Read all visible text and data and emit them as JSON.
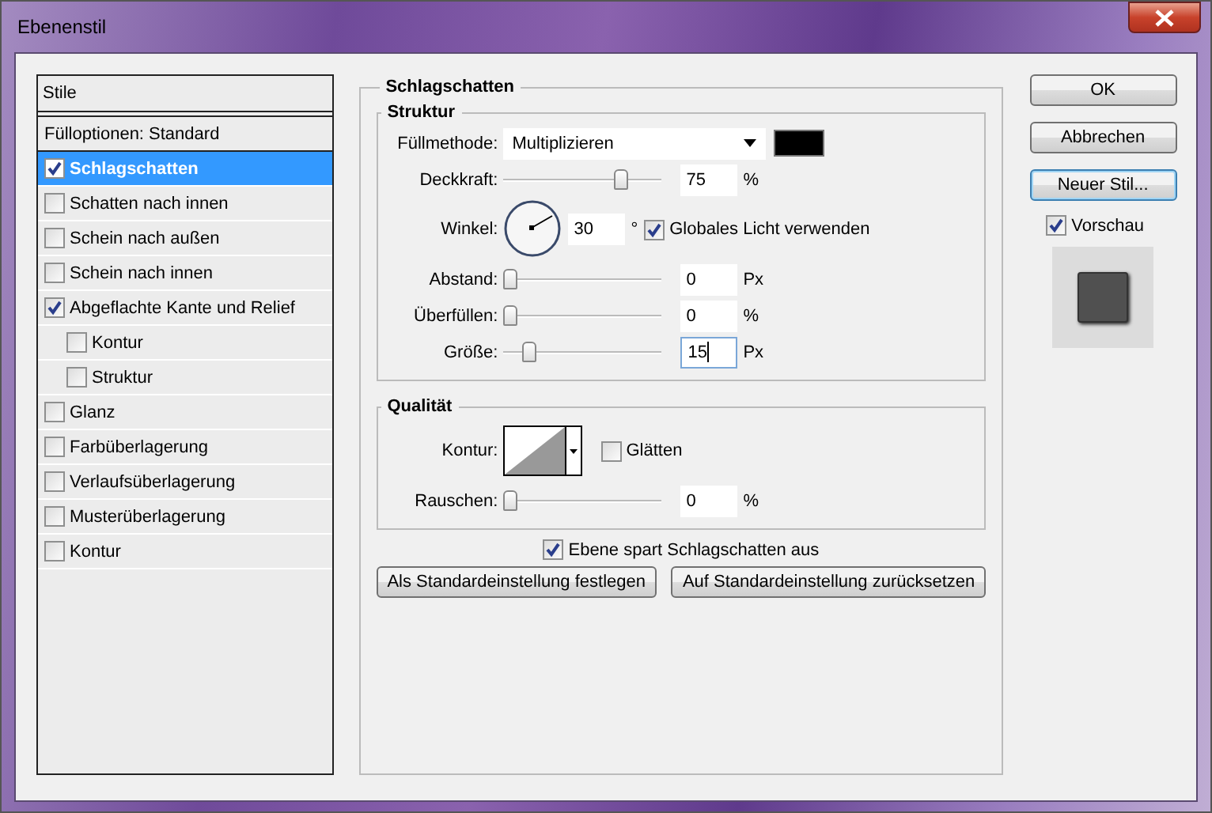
{
  "window": {
    "title": "Ebenenstil"
  },
  "styles": {
    "heading": "Stile",
    "items": [
      {
        "label": "Fülloptionen: Standard",
        "kind": "plain",
        "selected": false
      },
      {
        "label": "Schlagschatten",
        "kind": "check",
        "checked": true,
        "selected": true
      },
      {
        "label": "Schatten nach innen",
        "kind": "check",
        "checked": false,
        "selected": false
      },
      {
        "label": "Schein nach außen",
        "kind": "check",
        "checked": false,
        "selected": false
      },
      {
        "label": "Schein nach innen",
        "kind": "check",
        "checked": false,
        "selected": false
      },
      {
        "label": "Abgeflachte Kante und Relief",
        "kind": "check",
        "checked": true,
        "selected": false,
        "children": [
          {
            "label": "Kontur",
            "kind": "check",
            "checked": false,
            "selected": false
          },
          {
            "label": "Struktur",
            "kind": "check",
            "checked": false,
            "selected": false
          }
        ]
      },
      {
        "label": "Glanz",
        "kind": "check",
        "checked": false,
        "selected": false
      },
      {
        "label": "Farbüberlagerung",
        "kind": "check",
        "checked": false,
        "selected": false
      },
      {
        "label": "Verlaufsüberlagerung",
        "kind": "check",
        "checked": false,
        "selected": false
      },
      {
        "label": "Musterüberlagerung",
        "kind": "check",
        "checked": false,
        "selected": false
      },
      {
        "label": "Kontur",
        "kind": "check",
        "checked": false,
        "selected": false
      }
    ]
  },
  "panel": {
    "title": "Schlagschatten",
    "groups": [
      {
        "title": "Struktur",
        "rows": [
          {
            "kind": "blend",
            "label": "Füllmethode:",
            "value": "Multiplizieren",
            "color": "#000000"
          },
          {
            "kind": "slider",
            "label": "Deckkraft:",
            "level": 0.78,
            "value": "75",
            "unit": "%",
            "focused": false
          },
          {
            "kind": "angle",
            "label": "Winkel:",
            "value": "30",
            "unit": "°",
            "option": {
              "label": "Globales Licht verwenden",
              "checked": true
            }
          },
          {
            "kind": "slider",
            "label": "Abstand:",
            "level": 0,
            "value": "0",
            "unit": "Px",
            "focused": false
          },
          {
            "kind": "slider",
            "label": "Überfüllen:",
            "level": 0,
            "value": "0",
            "unit": "%",
            "focused": false
          },
          {
            "kind": "slider",
            "label": "Größe:",
            "level": 0.14,
            "value": "15",
            "unit": "Px",
            "focused": true
          }
        ]
      },
      {
        "title": "Qualität",
        "rows": [
          {
            "kind": "contour",
            "label": "Kontur:",
            "option": {
              "label": "Glätten",
              "checked": false
            }
          },
          {
            "kind": "slider",
            "label": "Rauschen:",
            "level": 0,
            "value": "0",
            "unit": "%",
            "focused": false
          }
        ]
      }
    ],
    "knockout": {
      "label": "Ebene spart Schlagschatten aus",
      "checked": true
    },
    "buttons": [
      "Als Standardeinstellung festlegen",
      "Auf Standardeinstellung zurücksetzen"
    ]
  },
  "actions": [
    {
      "label": "OK",
      "focused": false
    },
    {
      "label": "Abbrechen",
      "focused": false
    },
    {
      "label": "Neuer Stil...",
      "focused": true
    }
  ],
  "preview": {
    "label": "Vorschau",
    "checked": true
  }
}
